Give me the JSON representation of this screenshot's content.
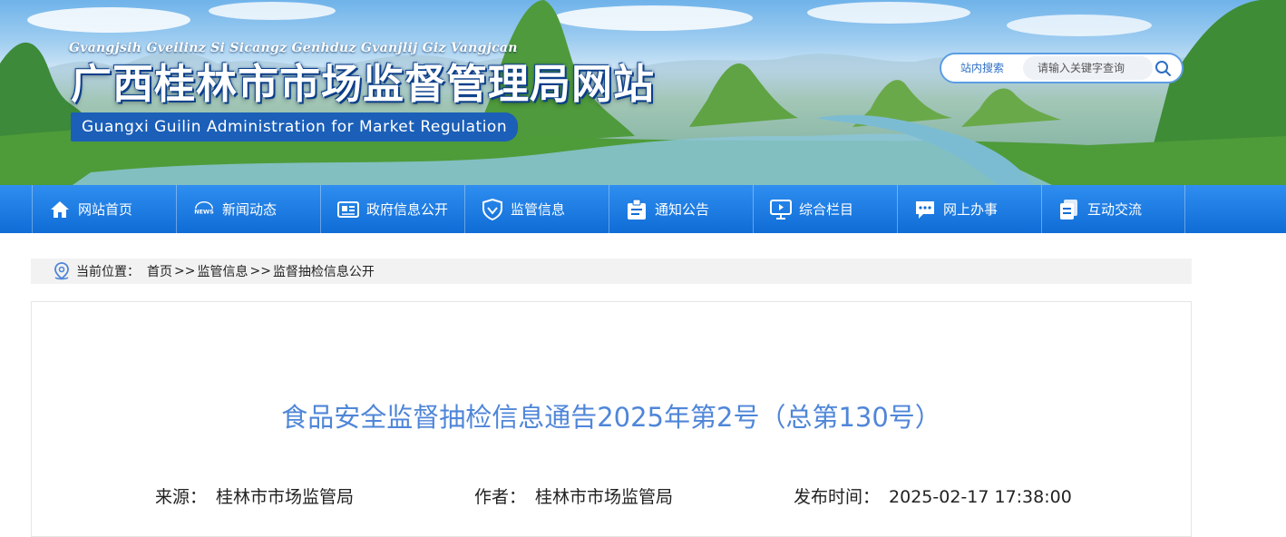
{
  "header": {
    "subtitle_zhuang": "Gvangjsih Gveilinz Si Sicangz Genhduz Gvanjlij Giz Vangjcan",
    "title": "广西桂林市市场监督管理局网站",
    "subtitle_en": "Guangxi Guilin Administration for Market Regulation",
    "search": {
      "label": "站内搜索",
      "placeholder": "请输入关键字查询",
      "icon": "search-icon"
    }
  },
  "nav": {
    "items": [
      {
        "label": "网站首页",
        "icon": "home-icon"
      },
      {
        "label": "新闻动态",
        "icon": "news-icon"
      },
      {
        "label": "政府信息公开",
        "icon": "newspaper-icon"
      },
      {
        "label": "监管信息",
        "icon": "shield-icon"
      },
      {
        "label": "通知公告",
        "icon": "clipboard-icon"
      },
      {
        "label": "综合栏目",
        "icon": "monitor-icon"
      },
      {
        "label": "网上办事",
        "icon": "chat-icon"
      },
      {
        "label": "互动交流",
        "icon": "document-icon"
      }
    ]
  },
  "breadcrumb": {
    "prefix": "当前位置：",
    "items": [
      "首页",
      "监管信息",
      "监督抽检信息公开"
    ],
    "separator": ">>"
  },
  "article": {
    "title": "食品安全监督抽检信息通告2025年第2号（总第130号）",
    "source_label": "来源：",
    "source": "桂林市市场监管局",
    "author_label": "作者：",
    "author": "桂林市市场监管局",
    "date_label": "发布时间：",
    "date": "2025-02-17 17:38:00"
  },
  "colors": {
    "nav_blue": "#0f6cd6",
    "title_blue": "#4f86d8",
    "english_badge": "#1b5fb8"
  }
}
